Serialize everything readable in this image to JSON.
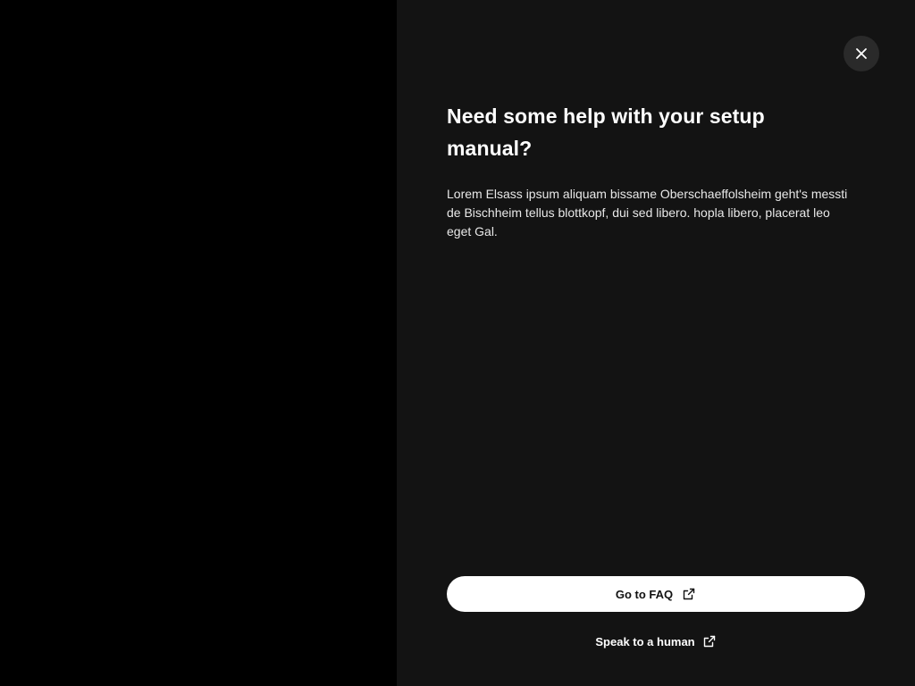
{
  "dialog": {
    "title": "Need some help with your setup manual?",
    "description": "Lorem Elsass ipsum aliquam bissame Oberschaeffolsheim geht's messti de Bischheim tellus blottkopf, dui sed libero. hopla libero, placerat leo eget Gal.",
    "close_icon": "close-icon"
  },
  "actions": {
    "faq_label": "Go to FAQ",
    "human_label": "Speak to a human",
    "external_icon": "external-link-icon"
  },
  "colors": {
    "backdrop": "#000000",
    "panel": "#131313",
    "primary_button": "#ffffff",
    "close_button_bg": "#2a2a2a"
  }
}
